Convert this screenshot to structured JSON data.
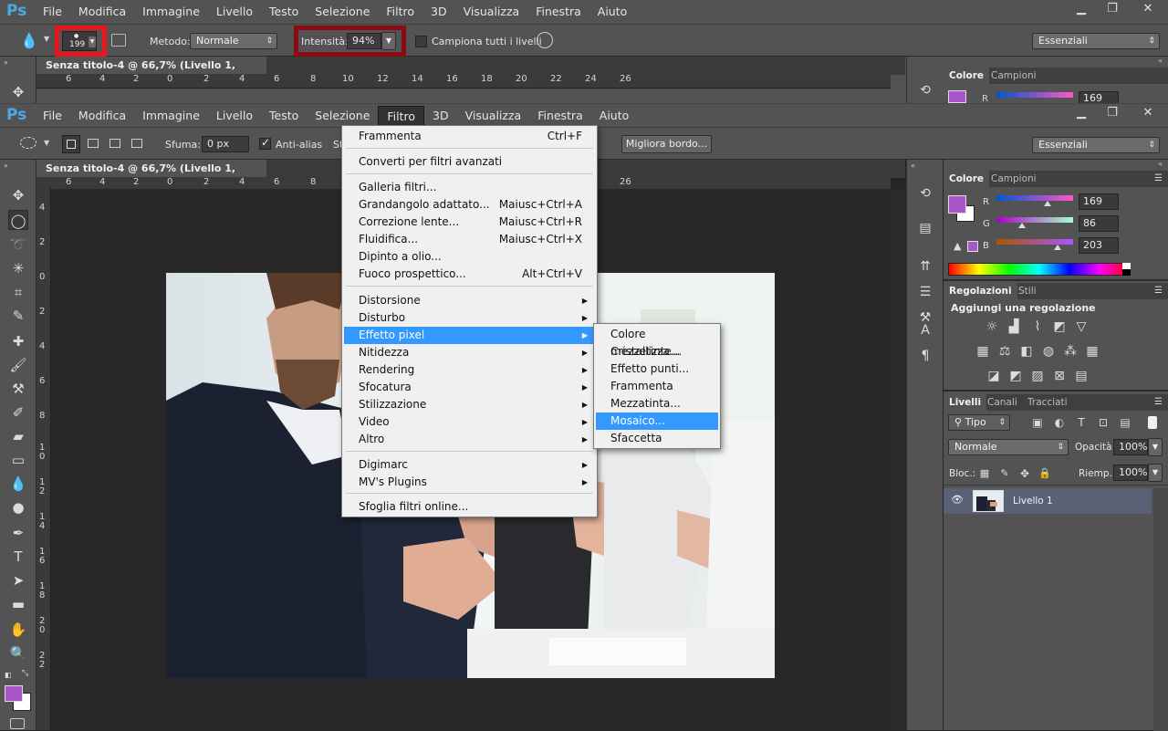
{
  "app": {
    "logo": "Ps",
    "menu": [
      "File",
      "Modifica",
      "Immagine",
      "Livello",
      "Testo",
      "Selezione",
      "Filtro",
      "3D",
      "Visualizza",
      "Finestra",
      "Aiuto"
    ],
    "window_controls": [
      "▁",
      "❐",
      "✕"
    ]
  },
  "top_pane": {
    "options": {
      "brush_size": "199",
      "metodo_label": "Metodo:",
      "metodo_value": "Normale",
      "intensita_label": "Intensità:",
      "intensita_value": "94%",
      "campiona_label": "Campiona tutti i livelli",
      "workspace": "Essenziali",
      "highlight_color": "#e8141e",
      "highlight_color2": "#8c0a12"
    },
    "doc_tab": "Senza titolo-4 @ 66,7% (Livello 1, RGB/8) *",
    "ruler": [
      "6",
      "4",
      "2",
      "0",
      "2",
      "4",
      "6",
      "8",
      "10",
      "12",
      "14",
      "16",
      "18",
      "20",
      "22",
      "24",
      "26"
    ],
    "panel_tabs": [
      "Colore",
      "Campioni"
    ],
    "r_label": "R",
    "r_value": "169"
  },
  "options": {
    "sfuma_label": "Sfuma:",
    "sfuma_value": "0 px",
    "antialias_label": "Anti-alias",
    "stile_label": "St",
    "migliora_label": "Migliora bordo...",
    "workspace": "Essenziali"
  },
  "document": {
    "tab": "Senza titolo-4 @ 66,7% (Livello 1, RGB/8) *",
    "close": "×",
    "ruler_h": [
      "6",
      "4",
      "2",
      "0",
      "2",
      "4",
      "6",
      "8",
      "10",
      "12",
      "14",
      "16",
      "18",
      "20",
      "22",
      "24",
      "26"
    ],
    "ruler_v": [
      "4",
      "2",
      "0",
      "2",
      "4",
      "6",
      "8",
      "1\n0",
      "1\n2",
      "1\n4",
      "1\n6",
      "1\n8",
      "2\n0",
      "2\n2"
    ]
  },
  "color_panel": {
    "tabs": [
      "Colore",
      "Campioni"
    ],
    "r_label": "R",
    "r_value": "169",
    "g_label": "G",
    "g_value": "86",
    "b_label": "B",
    "b_value": "203",
    "fg_color": "#a956cb",
    "bg_color": "#ffffff"
  },
  "adjust_panel": {
    "tabs": [
      "Regolazioni",
      "Stili"
    ],
    "heading": "Aggiungi una regolazione"
  },
  "layers_panel": {
    "tabs": [
      "Livelli",
      "Canali",
      "Tracciati"
    ],
    "filter_kind": "Tipo",
    "blend_mode": "Normale",
    "opacity_label": "Opacità:",
    "opacity_value": "100%",
    "lock_label": "Bloc.:",
    "fill_label": "Riemp.:",
    "fill_value": "100%",
    "layer_name": "Livello 1"
  },
  "filter_menu": {
    "items": [
      {
        "label": "Frammenta",
        "shortcut": "Ctrl+F"
      },
      {
        "label": "Converti per filtri avanzati"
      },
      {
        "label": "Galleria filtri..."
      },
      {
        "label": "Grandangolo adattato...",
        "shortcut": "Maiusc+Ctrl+A"
      },
      {
        "label": "Correzione lente...",
        "shortcut": "Maiusc+Ctrl+R"
      },
      {
        "label": "Fluidifica...",
        "shortcut": "Maiusc+Ctrl+X"
      },
      {
        "label": "Dipinto a olio..."
      },
      {
        "label": "Fuoco prospettico...",
        "shortcut": "Alt+Ctrl+V"
      },
      {
        "label": "Distorsione"
      },
      {
        "label": "Disturbo"
      },
      {
        "label": "Effetto pixel"
      },
      {
        "label": "Nitidezza"
      },
      {
        "label": "Rendering"
      },
      {
        "label": "Sfocatura"
      },
      {
        "label": "Stilizzazione"
      },
      {
        "label": "Video"
      },
      {
        "label": "Altro"
      },
      {
        "label": "Digimarc"
      },
      {
        "label": "MV's Plugins"
      },
      {
        "label": "Sfoglia filtri online..."
      }
    ],
    "submenu_arrow": "▶"
  },
  "pixel_submenu": {
    "items": [
      "Colore mezzetinte...",
      "Cristallizza...",
      "Effetto punti...",
      "Frammenta",
      "Mezzatinta...",
      "Mosaico...",
      "Sfaccetta"
    ]
  }
}
